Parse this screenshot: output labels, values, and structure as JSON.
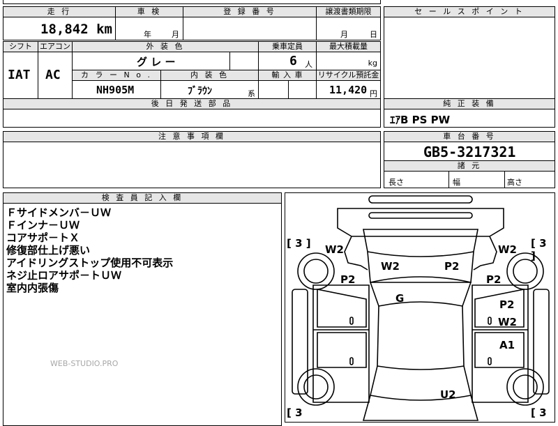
{
  "header": {
    "mileage_label": "走 行",
    "mileage_value": "18,842 km",
    "inspection_label": "車 検",
    "inspection_year": "年",
    "inspection_month": "月",
    "registration_label": "登 録 番 号",
    "transfer_label": "譲渡書類期限",
    "transfer_month": "月",
    "transfer_day": "日",
    "sales_point_label": "セ ー ル ス ポ イ ン ト"
  },
  "row2": {
    "shift_label": "シフト",
    "shift_value": "IAT",
    "ac_label": "エアコン",
    "ac_value": "AC",
    "exterior_label": "外 装 色",
    "exterior_value": "グ レ ー",
    "capacity_label": "乗車定員",
    "capacity_value": "6",
    "capacity_unit": "人",
    "load_label": "最大積載量",
    "load_unit": "kg",
    "color_no_label": "カ ラ ー N o .",
    "color_no_value": "NH905M",
    "interior_label": "内 装 色",
    "interior_value": "ﾌﾞﾗｳﾝ",
    "interior_suffix": "系",
    "import_label": "輸 入 車",
    "recycle_label": "リサイクル預託金",
    "recycle_value": "11,420",
    "recycle_unit": "円"
  },
  "later_parts_label": "後 日 発 送 部 品",
  "equipment": {
    "label": "純 正 装 備",
    "value": "ｴｱB PS PW"
  },
  "caution_label": "注 意 事 項 欄",
  "chassis": {
    "label": "車 台 番 号",
    "value": "GB5-3217321",
    "dims_label": "諸 元",
    "length": "長さ",
    "width": "幅",
    "height": "高さ"
  },
  "inspector": {
    "label": "検 査 員 記 入 欄",
    "notes": [
      "Ｆサイドメンバ－ＵＷ",
      "Ｆインナ－ＵＷ",
      "コアサポ－トＸ",
      "修復部仕上げ悪い",
      "アイドリングストップ使用不可表示",
      "ネジ止ロアサポ－トＵＷ",
      "室内内張傷"
    ],
    "watermark": "WEB-STUDIO.PRO"
  },
  "diagram": {
    "tire_left_front": "[ 3 ]",
    "tire_right_front": "[ 3 ]",
    "tire_left_rear": "[ 3",
    "tire_right_rear": "[ 3",
    "marks": {
      "front_left_fender": "W2",
      "front_right_fender": "W2",
      "hood_left": "W2",
      "hood_right": "P2",
      "left_fender_p": "P2",
      "right_fender_p": "P2",
      "roof": "G",
      "right_door_front_p": "P2",
      "right_door_front_w": "W2",
      "right_door_rear": "A1",
      "rear": "U2"
    }
  }
}
